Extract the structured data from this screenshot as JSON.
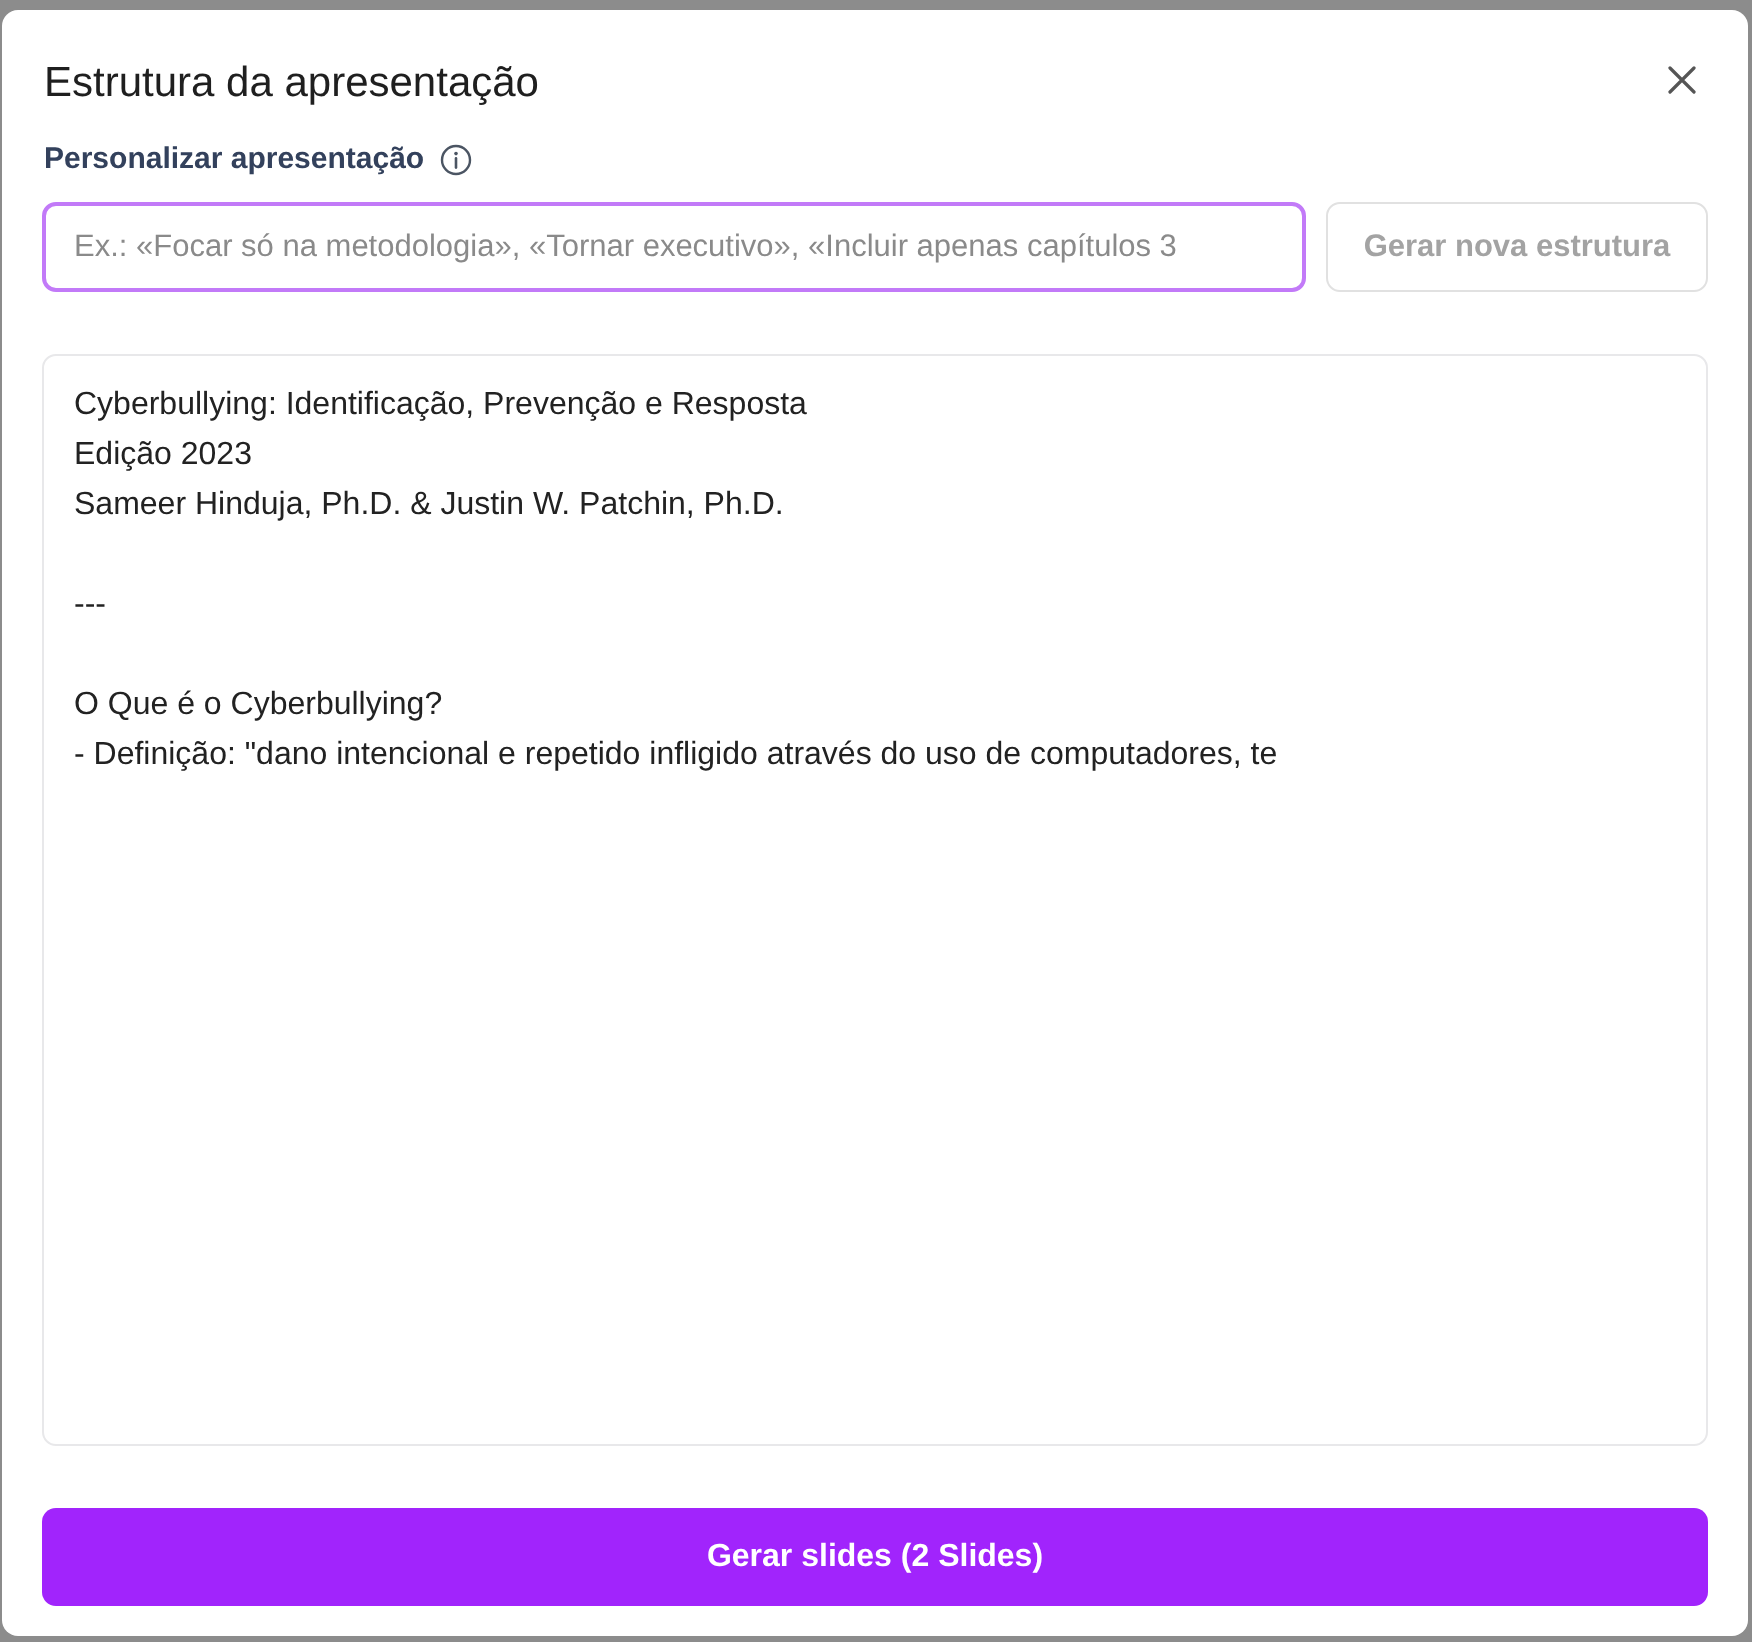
{
  "dialog": {
    "title": "Estrutura da apresentação"
  },
  "customize": {
    "label": "Personalizar apresentação",
    "input": {
      "placeholder": "Ex.: «Focar só na metodologia», «Tornar executivo», «Incluir apenas capítulos 3",
      "focused": true
    },
    "regenerate_button": {
      "label": "Gerar nova estrutura",
      "disabled": true
    }
  },
  "outline": {
    "value": "Cyberbullying: Identificação, Prevenção e Resposta\nEdição 2023\nSameer Hinduja, Ph.D. & Justin W. Patchin, Ph.D.\n\n---\n\nO Que é o Cyberbullying?\n- Definição: \"dano intencional e repetido infligido através do uso de computadores, te"
  },
  "generate_button": {
    "label": "Gerar slides (2 Slides)",
    "disabled": false
  }
}
